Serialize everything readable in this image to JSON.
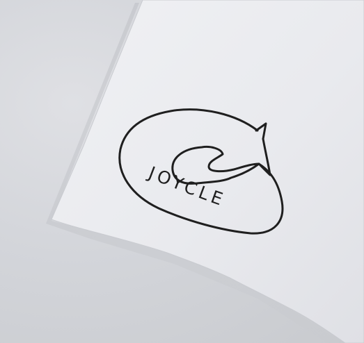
{
  "photo": {
    "background_color": "#d3d5da",
    "paper_color": "#ebecf0",
    "ink_color": "#1f1f1f"
  },
  "logo": {
    "brand_text": "JOYCLE",
    "icon": "cat-curled-arrow-icon"
  }
}
